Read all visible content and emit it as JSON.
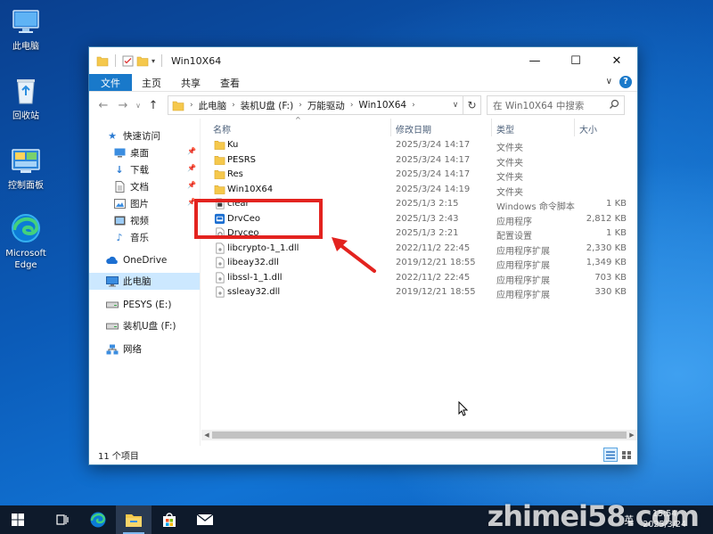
{
  "desktop": {
    "icons": [
      {
        "label": "此电脑",
        "icon": "this-pc-icon"
      },
      {
        "label": "回收站",
        "icon": "recycle-bin-icon"
      },
      {
        "label": "控制面板",
        "icon": "control-panel-icon"
      },
      {
        "label": "Microsoft Edge",
        "icon": "edge-icon"
      }
    ]
  },
  "window": {
    "title": "Win10X64",
    "controls": {
      "minimize": "—",
      "maximize": "☐",
      "close": "✕"
    },
    "ribbon": {
      "tabs": [
        "文件",
        "主页",
        "共享",
        "查看"
      ],
      "expand": "∨",
      "help": "?"
    },
    "address": {
      "crumbs": [
        "此电脑",
        "装机U盘 (F:)",
        "万能驱动",
        "Win10X64"
      ],
      "refresh": "↻"
    },
    "search": {
      "placeholder": "在 Win10X64 中搜索"
    },
    "sidebar": [
      {
        "label": "快速访问",
        "icon": "star-icon",
        "pinned": false,
        "selected": false
      },
      {
        "label": "桌面",
        "icon": "desktop-icon",
        "pinned": true,
        "selected": false
      },
      {
        "label": "下载",
        "icon": "download-icon",
        "pinned": true,
        "selected": false
      },
      {
        "label": "文档",
        "icon": "document-icon",
        "pinned": true,
        "selected": false
      },
      {
        "label": "图片",
        "icon": "pictures-icon",
        "pinned": true,
        "selected": false
      },
      {
        "label": "视频",
        "icon": "video-icon",
        "pinned": false,
        "selected": false
      },
      {
        "label": "音乐",
        "icon": "music-icon",
        "pinned": false,
        "selected": false
      },
      {
        "label": "OneDrive",
        "icon": "onedrive-icon",
        "pinned": false,
        "selected": false
      },
      {
        "label": "此电脑",
        "icon": "this-pc-icon",
        "pinned": false,
        "selected": true
      },
      {
        "label": "PESYS (E:)",
        "icon": "drive-icon",
        "pinned": false,
        "selected": false
      },
      {
        "label": "装机U盘 (F:)",
        "icon": "usb-drive-icon",
        "pinned": false,
        "selected": false
      },
      {
        "label": "网络",
        "icon": "network-icon",
        "pinned": false,
        "selected": false
      }
    ],
    "columns": {
      "name": "名称",
      "date": "修改日期",
      "type": "类型",
      "size": "大小"
    },
    "files": [
      {
        "name": "Ku",
        "date": "2025/3/24 14:17",
        "type": "文件夹",
        "size": "",
        "icon": "folder-icon"
      },
      {
        "name": "PESRS",
        "date": "2025/3/24 14:17",
        "type": "文件夹",
        "size": "",
        "icon": "folder-icon"
      },
      {
        "name": "Res",
        "date": "2025/3/24 14:17",
        "type": "文件夹",
        "size": "",
        "icon": "folder-icon"
      },
      {
        "name": "Win10X64",
        "date": "2025/3/24 14:19",
        "type": "文件夹",
        "size": "",
        "icon": "folder-icon"
      },
      {
        "name": "clear",
        "date": "2025/1/3 2:15",
        "type": "Windows 命令脚本",
        "size": "1 KB",
        "icon": "script-icon"
      },
      {
        "name": "DrvCeo",
        "date": "2025/1/3 2:43",
        "type": "应用程序",
        "size": "2,812 KB",
        "icon": "app-icon"
      },
      {
        "name": "Drvceo",
        "date": "2025/1/3 2:21",
        "type": "配置设置",
        "size": "1 KB",
        "icon": "config-icon"
      },
      {
        "name": "libcrypto-1_1.dll",
        "date": "2022/11/2 22:45",
        "type": "应用程序扩展",
        "size": "2,330 KB",
        "icon": "dll-icon"
      },
      {
        "name": "libeay32.dll",
        "date": "2019/12/21 18:55",
        "type": "应用程序扩展",
        "size": "1,349 KB",
        "icon": "dll-icon"
      },
      {
        "name": "libssl-1_1.dll",
        "date": "2022/11/2 22:45",
        "type": "应用程序扩展",
        "size": "703 KB",
        "icon": "dll-icon"
      },
      {
        "name": "ssleay32.dll",
        "date": "2019/12/21 18:55",
        "type": "应用程序扩展",
        "size": "330 KB",
        "icon": "dll-icon"
      }
    ],
    "status": "11 个项目"
  },
  "taskbar": {
    "items": [
      "start-icon",
      "task-view-icon",
      "edge-icon",
      "file-explorer-icon",
      "store-icon",
      "mail-icon"
    ],
    "active": "file-explorer-icon",
    "tray": {
      "lang": "英",
      "time": "15:54",
      "date": "2025/3/24"
    }
  },
  "watermark": "zhimei58.com",
  "colors": {
    "accent": "#1979ca",
    "highlight": "#e3231f",
    "selection": "#cce8ff",
    "taskbar": "#0e1a2b"
  }
}
